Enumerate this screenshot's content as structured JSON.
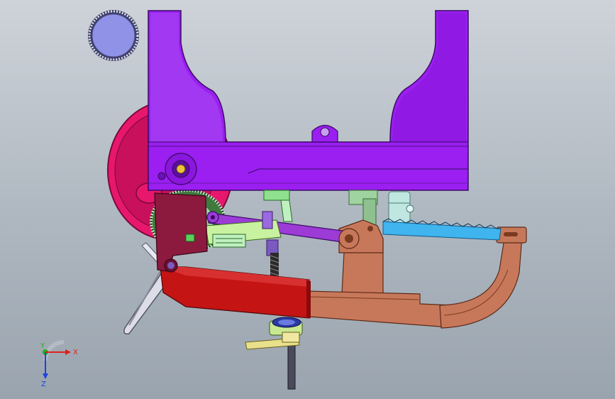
{
  "viewport": {
    "background_top": "#ced3d9",
    "background_bottom": "#9aa4ae"
  },
  "triad": {
    "x_label": "X",
    "y_label": "Y",
    "z_label": "Z",
    "x_color": "#e02020",
    "y_color": "#20b020",
    "z_color": "#2040e0"
  },
  "parts": {
    "frame_color": "#9a1ff0",
    "wheel_color": "#e8176e",
    "knob_color": "#8f92e6",
    "clamp_color": "#c41414",
    "arm_color": "#c8785a",
    "blade_color": "#3fb4ee",
    "link_color": "#9c3bd6",
    "gear_color": "#2f8f2f",
    "crank_color": "#8b1a3e"
  }
}
